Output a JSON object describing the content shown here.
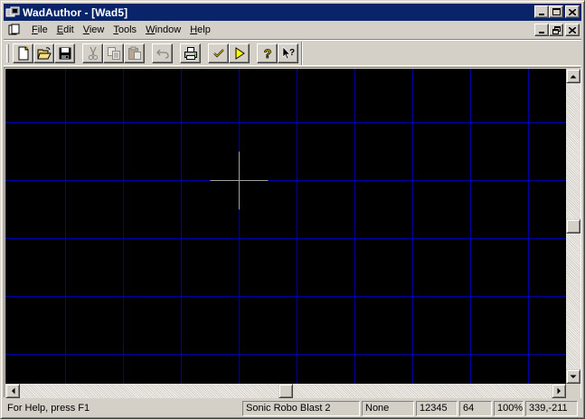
{
  "window": {
    "title": "WadAuthor - [Wad5]",
    "title_bar_color": "#0a246a",
    "icon": "wadauthor-app-icon"
  },
  "menu": {
    "items": [
      {
        "key": "file",
        "label": "File"
      },
      {
        "key": "edit",
        "label": "Edit"
      },
      {
        "key": "view",
        "label": "View"
      },
      {
        "key": "tools",
        "label": "Tools"
      },
      {
        "key": "window",
        "label": "Window"
      },
      {
        "key": "help",
        "label": "Help"
      }
    ]
  },
  "toolbar": {
    "buttons": [
      {
        "key": "new",
        "icon": "new-file-icon",
        "enabled": true
      },
      {
        "key": "open",
        "icon": "open-folder-icon",
        "enabled": true
      },
      {
        "key": "save",
        "icon": "save-disk-icon",
        "enabled": true
      },
      {
        "key": "cut",
        "icon": "scissors-icon",
        "enabled": false
      },
      {
        "key": "copy",
        "icon": "copy-icon",
        "enabled": false
      },
      {
        "key": "paste",
        "icon": "paste-icon",
        "enabled": false
      },
      {
        "key": "undo",
        "icon": "undo-icon",
        "enabled": false
      },
      {
        "key": "print",
        "icon": "printer-icon",
        "enabled": true
      },
      {
        "key": "check",
        "icon": "checkmark-icon",
        "enabled": true
      },
      {
        "key": "run",
        "icon": "play-icon",
        "enabled": true
      },
      {
        "key": "help",
        "icon": "help-question-icon",
        "enabled": true
      },
      {
        "key": "context-help",
        "icon": "context-help-arrow-icon",
        "enabled": true
      }
    ]
  },
  "canvas": {
    "background": "#000000",
    "grid_color": "#0000a8",
    "crosshair_color": "#a0a0a0"
  },
  "status": {
    "help_text": "For Help, press F1",
    "game": "Sonic Robo Blast 2",
    "mode": "None",
    "value": "12345",
    "grid_size": "64",
    "zoom": "100%",
    "coords": "339,-211"
  }
}
